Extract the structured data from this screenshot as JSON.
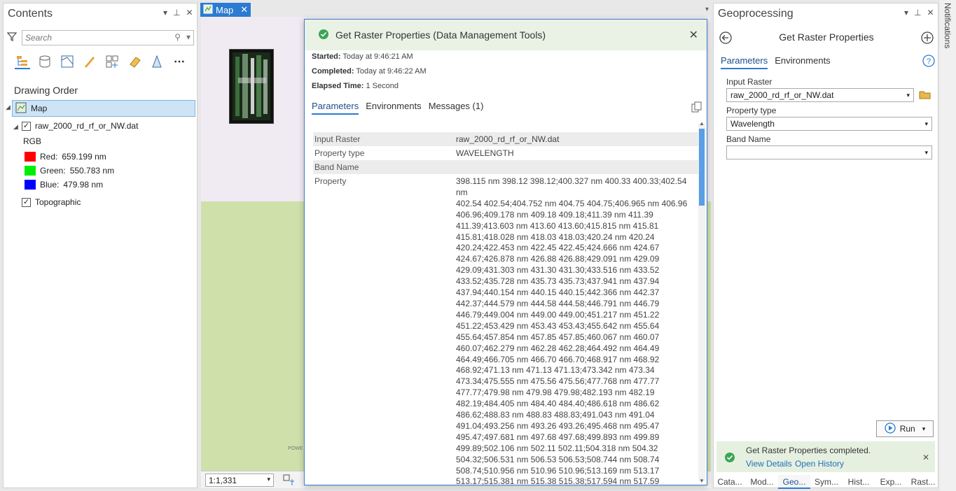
{
  "contents": {
    "title": "Contents",
    "search_placeholder": "Search",
    "drawing_order_label": "Drawing Order",
    "map_label": "Map",
    "layer_name": "raw_2000_rd_rf_or_NW.dat",
    "rgb_label": "RGB",
    "bands": [
      {
        "label": "Red:",
        "value": "659.199 nm",
        "color": "#ff0000"
      },
      {
        "label": "Green:",
        "value": "550.783 nm",
        "color": "#00ee00"
      },
      {
        "label": "Blue:",
        "value": "479.98 nm",
        "color": "#0000ff"
      }
    ],
    "basemap_name": "Topographic"
  },
  "map": {
    "tab_label": "Map",
    "scale": "1:1,331",
    "attribution": "POWE"
  },
  "popup": {
    "title": "Get Raster Properties (Data Management Tools)",
    "started_label": "Started:",
    "started_value": "Today at 9:46:21 AM",
    "completed_label": "Completed:",
    "completed_value": "Today at 9:46:22 AM",
    "elapsed_label": "Elapsed Time:",
    "elapsed_value": "1 Second",
    "tabs": [
      "Parameters",
      "Environments",
      "Messages (1)"
    ],
    "rows": [
      {
        "key": "Input Raster",
        "value": "raw_2000_rd_rf_or_NW.dat"
      },
      {
        "key": "Property type",
        "value": "WAVELENGTH"
      },
      {
        "key": "Band Name",
        "value": ""
      },
      {
        "key": "Property",
        "value": ""
      }
    ],
    "property_lines": [
      "398.115 nm 398.12 398.12;400.327 nm 400.33 400.33;402.54 nm",
      "402.54 402.54;404.752 nm 404.75 404.75;406.965 nm 406.96",
      "406.96;409.178 nm 409.18 409.18;411.39 nm 411.39",
      "411.39;413.603 nm 413.60 413.60;415.815 nm 415.81",
      "415.81;418.028 nm 418.03 418.03;420.24 nm 420.24",
      "420.24;422.453 nm 422.45 422.45;424.666 nm 424.67",
      "424.67;426.878 nm 426.88 426.88;429.091 nm 429.09",
      "429.09;431.303 nm 431.30 431.30;433.516 nm 433.52",
      "433.52;435.728 nm 435.73 435.73;437.941 nm 437.94",
      "437.94;440.154 nm 440.15 440.15;442.366 nm 442.37",
      "442.37;444.579 nm 444.58 444.58;446.791 nm 446.79",
      "446.79;449.004 nm 449.00 449.00;451.217 nm 451.22",
      "451.22;453.429 nm 453.43 453.43;455.642 nm 455.64",
      "455.64;457.854 nm 457.85 457.85;460.067 nm 460.07",
      "460.07;462.279 nm 462.28 462.28;464.492 nm 464.49",
      "464.49;466.705 nm 466.70 466.70;468.917 nm 468.92",
      "468.92;471.13 nm 471.13 471.13;473.342 nm 473.34",
      "473.34;475.555 nm 475.56 475.56;477.768 nm 477.77",
      "477.77;479.98 nm 479.98 479.98;482.193 nm 482.19",
      "482.19;484.405 nm 484.40 484.40;486.618 nm 486.62",
      "486.62;488.83 nm 488.83 488.83;491.043 nm 491.04",
      "491.04;493.256 nm 493.26 493.26;495.468 nm 495.47",
      "495.47;497.681 nm 497.68 497.68;499.893 nm 499.89",
      "499.89;502.106 nm 502.11 502.11;504.318 nm 504.32",
      "504.32;506.531 nm 506.53 506.53;508.744 nm 508.74",
      "508.74;510.956 nm 510.96 510.96;513.169 nm 513.17",
      "513.17;515.381 nm 515.38 515.38;517.594 nm 517.59"
    ]
  },
  "geoprocessing": {
    "title": "Geoprocessing",
    "tool_title": "Get Raster Properties",
    "tabs": [
      "Parameters",
      "Environments"
    ],
    "input_raster_label": "Input Raster",
    "input_raster_value": "raw_2000_rd_rf_or_NW.dat",
    "property_type_label": "Property type",
    "property_type_value": "Wavelength",
    "band_name_label": "Band Name",
    "band_name_value": "",
    "run_label": "Run",
    "status_message": "Get Raster Properties completed.",
    "view_details": "View Details",
    "open_history": "Open History",
    "bottom_tabs": [
      "Cata...",
      "Mod...",
      "Geo...",
      "Sym...",
      "Hist...",
      "Exp...",
      "Rast..."
    ]
  },
  "notifications_label": "Notifications",
  "colors": {
    "accent": "#2b7bd1",
    "success": "#3aa655"
  }
}
